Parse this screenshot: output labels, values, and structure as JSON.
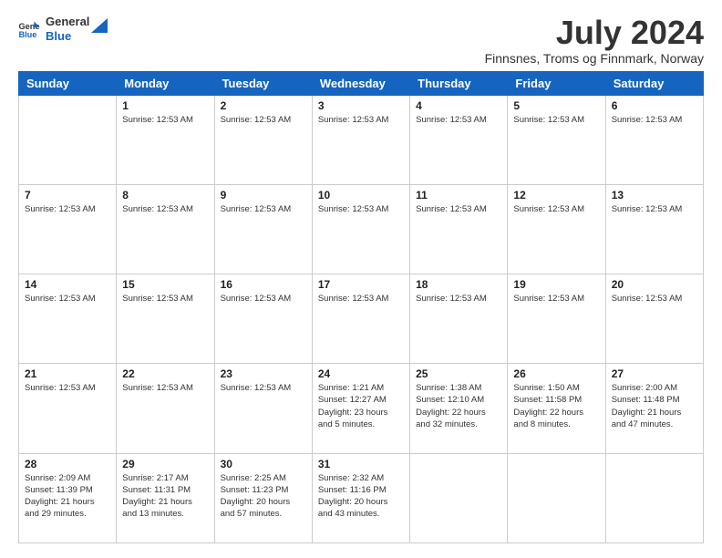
{
  "logo": {
    "line1": "General",
    "line2": "Blue"
  },
  "title": "July 2024",
  "subtitle": "Finnsnes, Troms og Finnmark, Norway",
  "header_days": [
    "Sunday",
    "Monday",
    "Tuesday",
    "Wednesday",
    "Thursday",
    "Friday",
    "Saturday"
  ],
  "weeks": [
    [
      {
        "day": "",
        "info": ""
      },
      {
        "day": "1",
        "info": "Sunrise: 12:53 AM"
      },
      {
        "day": "2",
        "info": "Sunrise: 12:53 AM"
      },
      {
        "day": "3",
        "info": "Sunrise: 12:53 AM"
      },
      {
        "day": "4",
        "info": "Sunrise: 12:53 AM"
      },
      {
        "day": "5",
        "info": "Sunrise: 12:53 AM"
      },
      {
        "day": "6",
        "info": "Sunrise: 12:53 AM"
      }
    ],
    [
      {
        "day": "7",
        "info": "Sunrise: 12:53 AM"
      },
      {
        "day": "8",
        "info": "Sunrise: 12:53 AM"
      },
      {
        "day": "9",
        "info": "Sunrise: 12:53 AM"
      },
      {
        "day": "10",
        "info": "Sunrise: 12:53 AM"
      },
      {
        "day": "11",
        "info": "Sunrise: 12:53 AM"
      },
      {
        "day": "12",
        "info": "Sunrise: 12:53 AM"
      },
      {
        "day": "13",
        "info": "Sunrise: 12:53 AM"
      }
    ],
    [
      {
        "day": "14",
        "info": "Sunrise: 12:53 AM"
      },
      {
        "day": "15",
        "info": "Sunrise: 12:53 AM"
      },
      {
        "day": "16",
        "info": "Sunrise: 12:53 AM"
      },
      {
        "day": "17",
        "info": "Sunrise: 12:53 AM"
      },
      {
        "day": "18",
        "info": "Sunrise: 12:53 AM"
      },
      {
        "day": "19",
        "info": "Sunrise: 12:53 AM"
      },
      {
        "day": "20",
        "info": "Sunrise: 12:53 AM"
      }
    ],
    [
      {
        "day": "21",
        "info": "Sunrise: 12:53 AM"
      },
      {
        "day": "22",
        "info": "Sunrise: 12:53 AM"
      },
      {
        "day": "23",
        "info": "Sunrise: 12:53 AM"
      },
      {
        "day": "24",
        "info": "Sunrise: 1:21 AM\nSunset: 12:27 AM\nDaylight: 23 hours and 5 minutes."
      },
      {
        "day": "25",
        "info": "Sunrise: 1:38 AM\nSunset: 12:10 AM\nDaylight: 22 hours and 32 minutes."
      },
      {
        "day": "26",
        "info": "Sunrise: 1:50 AM\nSunset: 11:58 PM\nDaylight: 22 hours and 8 minutes."
      },
      {
        "day": "27",
        "info": "Sunrise: 2:00 AM\nSunset: 11:48 PM\nDaylight: 21 hours and 47 minutes."
      }
    ],
    [
      {
        "day": "28",
        "info": "Sunrise: 2:09 AM\nSunset: 11:39 PM\nDaylight: 21 hours and 29 minutes."
      },
      {
        "day": "29",
        "info": "Sunrise: 2:17 AM\nSunset: 11:31 PM\nDaylight: 21 hours and 13 minutes."
      },
      {
        "day": "30",
        "info": "Sunrise: 2:25 AM\nSunset: 11:23 PM\nDaylight: 20 hours and 57 minutes."
      },
      {
        "day": "31",
        "info": "Sunrise: 2:32 AM\nSunset: 11:16 PM\nDaylight: 20 hours and 43 minutes."
      },
      {
        "day": "",
        "info": ""
      },
      {
        "day": "",
        "info": ""
      },
      {
        "day": "",
        "info": ""
      }
    ]
  ]
}
